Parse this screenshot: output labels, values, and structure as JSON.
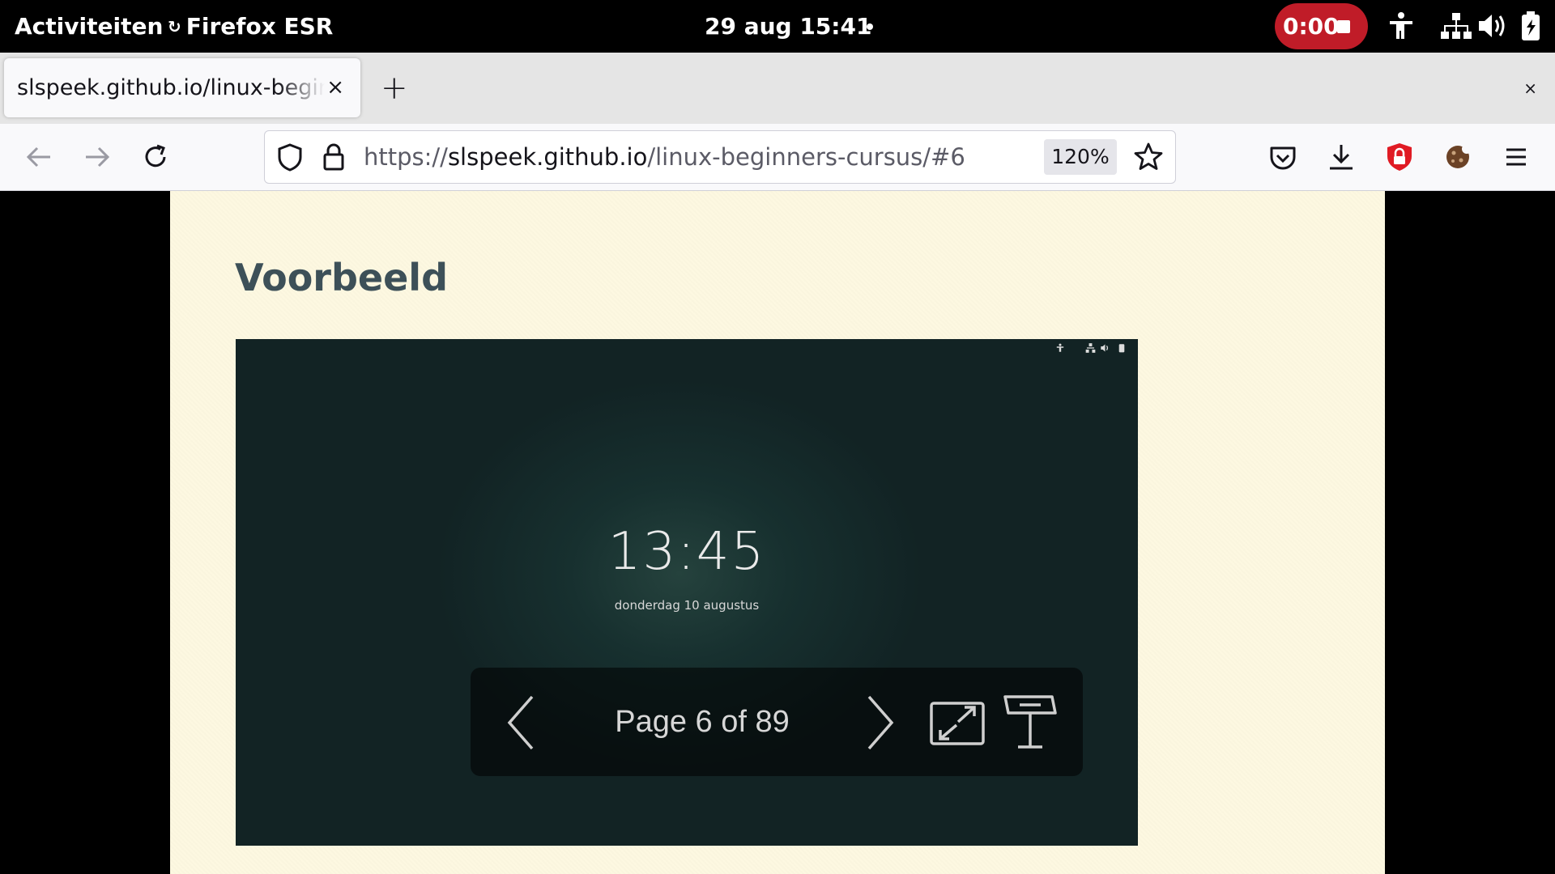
{
  "topbar": {
    "activities": "Activiteiten",
    "app_name": "Firefox ESR",
    "datetime": "29 aug  15:41",
    "recording_time": "0:00"
  },
  "browser": {
    "tab_title": "slspeek.github.io/linux-beginners-cursus/#6",
    "new_tab": "+",
    "close_tab": "×",
    "close_window": "×",
    "url_prefix": "https://",
    "url_host": "slspeek.github.io",
    "url_path": "/linux-beginners-cursus/#6",
    "zoom": "120%"
  },
  "page": {
    "heading": "Voorbeeld",
    "lockscreen": {
      "time": "13:45",
      "date": "donderdag 10 augustus"
    },
    "pdf_viewer": {
      "page_label": "Page 6 of 89"
    }
  },
  "colors": {
    "topbar_bg": "#000000",
    "record_red": "#c01c28",
    "page_bg": "#fdf8e1",
    "heading": "#3d5058",
    "screenshot_bg": "#17302f",
    "ublock_red": "#e01b24"
  },
  "icons": [
    "firefox-icon",
    "stop-icon",
    "accessibility-icon",
    "network-icon",
    "volume-icon",
    "battery-icon",
    "back-icon",
    "forward-icon",
    "reload-icon",
    "shield-icon",
    "lock-icon",
    "star-icon",
    "pocket-icon",
    "download-icon",
    "ublock-icon",
    "cookie-icon",
    "menu-icon",
    "chevron-left-icon",
    "chevron-right-icon",
    "fullscreen-icon",
    "presentation-icon"
  ]
}
